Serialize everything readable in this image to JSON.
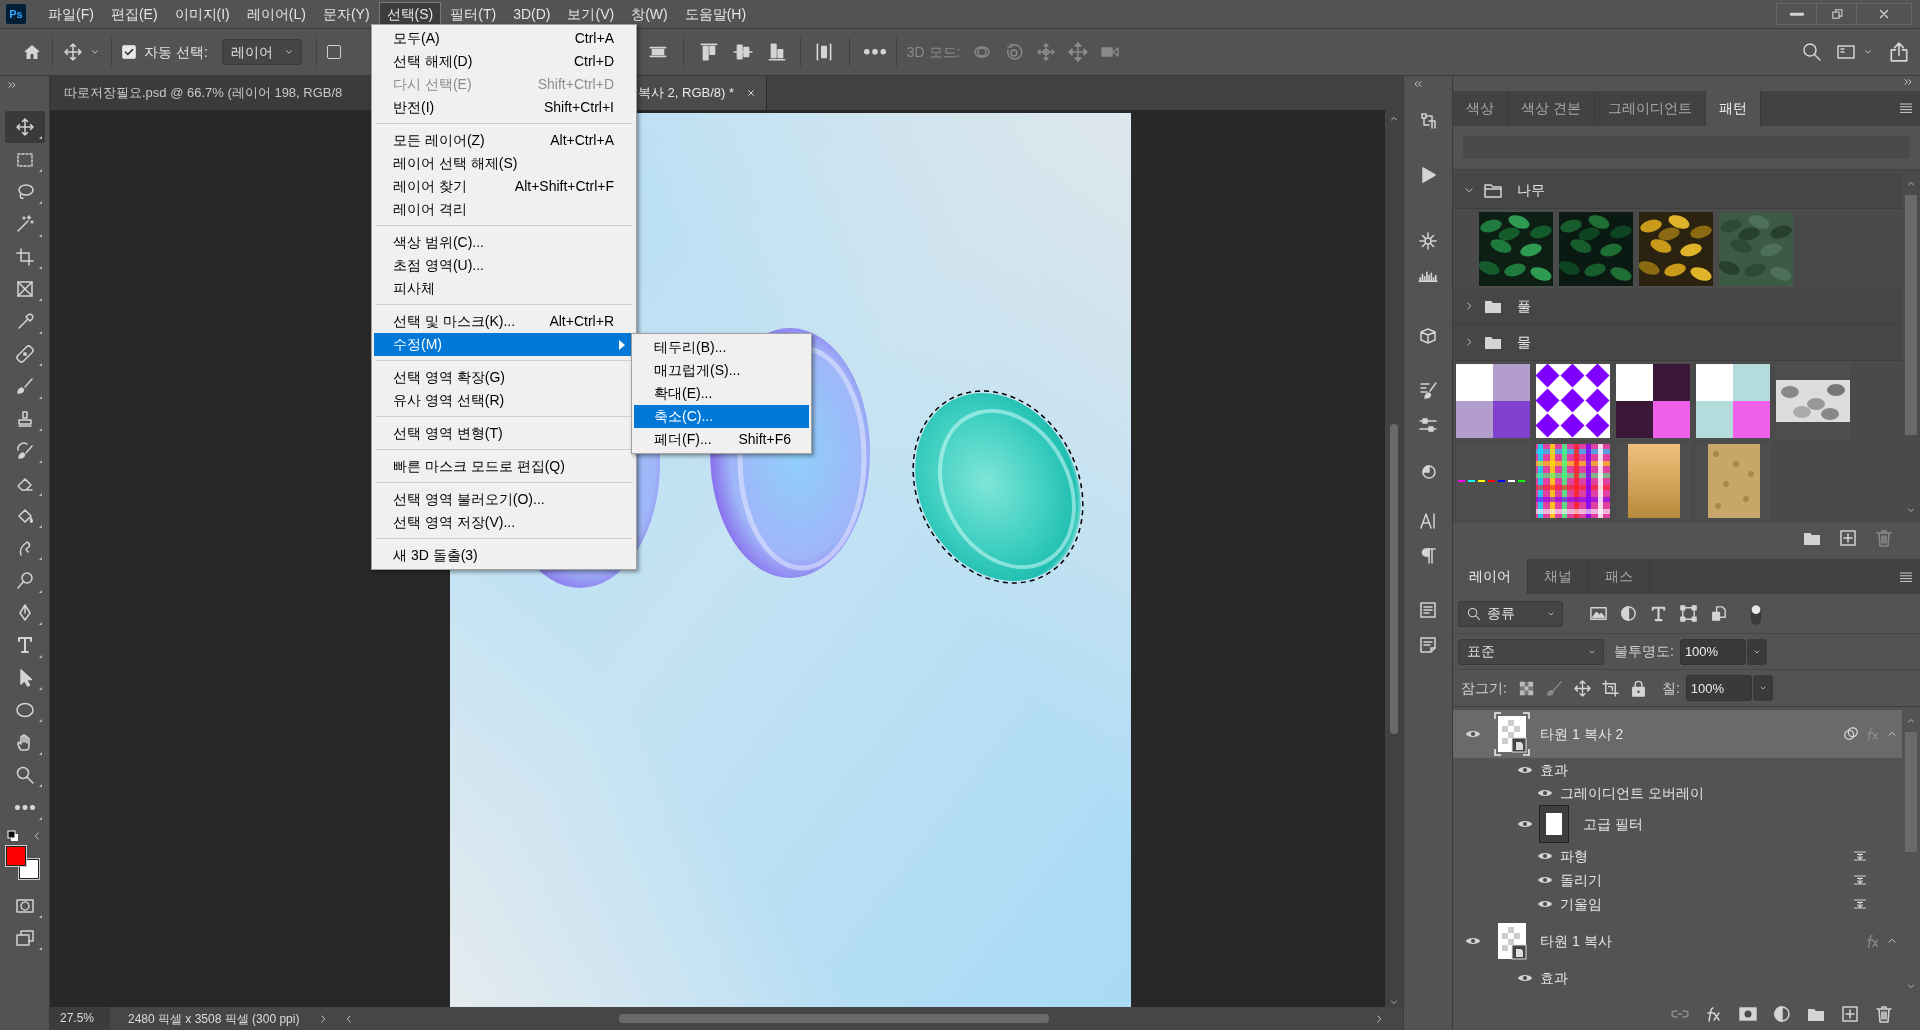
{
  "app_logo": "Ps",
  "menu_bar": {
    "items": [
      {
        "label": "파일(F)",
        "selected": false
      },
      {
        "label": "편집(E)",
        "selected": false
      },
      {
        "label": "이미지(I)",
        "selected": false
      },
      {
        "label": "레이어(L)",
        "selected": false
      },
      {
        "label": "문자(Y)",
        "selected": false
      },
      {
        "label": "선택(S)",
        "selected": true
      },
      {
        "label": "필터(T)",
        "selected": false
      },
      {
        "label": "3D(D)",
        "selected": false
      },
      {
        "label": "보기(V)",
        "selected": false
      },
      {
        "label": "창(W)",
        "selected": false
      },
      {
        "label": "도움말(H)",
        "selected": false
      }
    ]
  },
  "options_bar": {
    "auto_select": {
      "label": "자동 선택:",
      "checked": true
    },
    "auto_select_target": "레이어",
    "transform_controls": {
      "checked": false
    },
    "mode_3d_label": "3D 모드:"
  },
  "document_tabs": [
    {
      "title": "따로저장필요.psd @ 66.7% (레이어 198, RGB/8",
      "selected": false
    },
    {
      "title": "복사 2, RGB/8) *",
      "selected": true
    }
  ],
  "select_menu": {
    "groups": [
      [
        {
          "label": "모두(A)",
          "shortcut": "Ctrl+A",
          "kind": "command",
          "disabled": false,
          "selected": false
        },
        {
          "label": "선택 해제(D)",
          "shortcut": "Ctrl+D",
          "kind": "command",
          "disabled": false,
          "selected": false
        },
        {
          "label": "다시 선택(E)",
          "shortcut": "Shift+Ctrl+D",
          "kind": "command",
          "disabled": true,
          "selected": false
        },
        {
          "label": "반전(I)",
          "shortcut": "Shift+Ctrl+I",
          "kind": "command",
          "disabled": false,
          "selected": false
        }
      ],
      [
        {
          "label": "모든 레이어(Z)",
          "shortcut": "Alt+Ctrl+A",
          "kind": "command",
          "disabled": false,
          "selected": false
        },
        {
          "label": "레이어 선택 해제(S)",
          "kind": "command",
          "disabled": false,
          "selected": false
        },
        {
          "label": "레이어 찾기",
          "shortcut": "Alt+Shift+Ctrl+F",
          "kind": "command",
          "disabled": false,
          "selected": false
        },
        {
          "label": "레이어 격리",
          "kind": "command",
          "disabled": false,
          "selected": false
        }
      ],
      [
        {
          "label": "색상 범위(C)...",
          "kind": "command",
          "disabled": false,
          "selected": false
        },
        {
          "label": "초점 영역(U)...",
          "kind": "command",
          "disabled": false,
          "selected": false
        },
        {
          "label": "피사체",
          "kind": "command",
          "disabled": false,
          "selected": false
        }
      ],
      [
        {
          "label": "선택 및 마스크(K)...",
          "shortcut": "Alt+Ctrl+R",
          "kind": "command",
          "disabled": false,
          "selected": false
        },
        {
          "label": "수정(M)",
          "kind": "submenu",
          "disabled": false,
          "selected": true
        }
      ],
      [
        {
          "label": "선택 영역 확장(G)",
          "kind": "command",
          "disabled": false,
          "selected": false
        },
        {
          "label": "유사 영역 선택(R)",
          "kind": "command",
          "disabled": false,
          "selected": false
        }
      ],
      [
        {
          "label": "선택 영역 변형(T)",
          "kind": "command",
          "disabled": false,
          "selected": false
        }
      ],
      [
        {
          "label": "빠른 마스크 모드로 편집(Q)",
          "kind": "command",
          "disabled": false,
          "selected": false
        }
      ],
      [
        {
          "label": "선택 영역 불러오기(O)...",
          "kind": "command",
          "disabled": false,
          "selected": false
        },
        {
          "label": "선택 영역 저장(V)...",
          "kind": "command",
          "disabled": false,
          "selected": false
        }
      ],
      [
        {
          "label": "새 3D 돌출(3)",
          "kind": "command",
          "disabled": false,
          "selected": false
        }
      ]
    ]
  },
  "modify_submenu": {
    "items": [
      {
        "label": "테두리(B)...",
        "selected": false
      },
      {
        "label": "매끄럽게(S)...",
        "selected": false
      },
      {
        "label": "확대(E)...",
        "selected": false
      },
      {
        "label": "축소(C)...",
        "selected": true
      },
      {
        "label": "페더(F)...",
        "shortcut": "Shift+F6",
        "selected": false
      }
    ]
  },
  "tools": [
    {
      "kind": "move",
      "selected": true
    },
    {
      "kind": "marquee",
      "selected": false
    },
    {
      "kind": "lasso",
      "selected": false
    },
    {
      "kind": "magic_wand",
      "selected": false
    },
    {
      "kind": "crop",
      "selected": false
    },
    {
      "kind": "frame",
      "selected": false
    },
    {
      "kind": "eyedropper",
      "selected": false
    },
    {
      "kind": "healing",
      "selected": false
    },
    {
      "kind": "brush",
      "selected": false
    },
    {
      "kind": "stamp",
      "selected": false
    },
    {
      "kind": "history_brush",
      "selected": false
    },
    {
      "kind": "eraser",
      "selected": false
    },
    {
      "kind": "bucket",
      "selected": false
    },
    {
      "kind": "smudge",
      "selected": false
    },
    {
      "kind": "dodge",
      "selected": false
    },
    {
      "kind": "pen",
      "selected": false
    },
    {
      "kind": "type",
      "selected": false
    },
    {
      "kind": "path_select",
      "selected": false
    },
    {
      "kind": "ellipse",
      "selected": false
    },
    {
      "kind": "hand",
      "selected": false
    },
    {
      "kind": "zoom",
      "selected": false
    },
    {
      "kind": "more",
      "selected": false
    }
  ],
  "color_swatches": [
    {
      "kind": "foreground",
      "color": "#ff0000"
    },
    {
      "kind": "background",
      "color": "#ffffff"
    }
  ],
  "status_bar": {
    "zoom": "27.5%",
    "document_size": "2480 픽셀 x 3508 픽셀 (300 ppi)"
  },
  "patterns_panel": {
    "tabs": [
      {
        "label": "색상",
        "selected": false
      },
      {
        "label": "색상 견본",
        "selected": false
      },
      {
        "label": "그레이디언트",
        "selected": false
      },
      {
        "label": "패턴",
        "selected": true
      }
    ],
    "groups": [
      {
        "name": "나무",
        "expanded": true
      },
      {
        "name": "풀",
        "expanded": false
      },
      {
        "name": "물",
        "expanded": false
      }
    ]
  },
  "layers_panel": {
    "tabs": [
      {
        "label": "레이어",
        "selected": true
      },
      {
        "label": "채널",
        "selected": false
      },
      {
        "label": "패스",
        "selected": false
      }
    ],
    "filter_kind": "종류",
    "blend_mode": "표준",
    "opacity_label": "불투명도:",
    "opacity": "100%",
    "lock_label": "잠그기:",
    "fill_label": "칠:",
    "fill": "100%",
    "layers": [
      {
        "name": "타원 1 복사 2",
        "kind": "layer",
        "visible": true,
        "selected": true,
        "children": [
          {
            "name": "효과",
            "kind": "effects",
            "visible": true,
            "children": [
              {
                "name": "그레이디언트 오버레이",
                "kind": "effect",
                "visible": true
              }
            ]
          },
          {
            "name": "고급 필터",
            "kind": "smart_filters",
            "visible": true,
            "children": [
              {
                "name": "파형",
                "kind": "filter",
                "visible": true
              },
              {
                "name": "돌리기",
                "kind": "filter",
                "visible": true
              },
              {
                "name": "기울임",
                "kind": "filter",
                "visible": true
              }
            ]
          }
        ]
      },
      {
        "name": "타원 1 복사",
        "kind": "layer",
        "visible": true,
        "selected": false,
        "children": [
          {
            "name": "효과",
            "kind": "effects",
            "visible": true
          }
        ]
      }
    ]
  }
}
